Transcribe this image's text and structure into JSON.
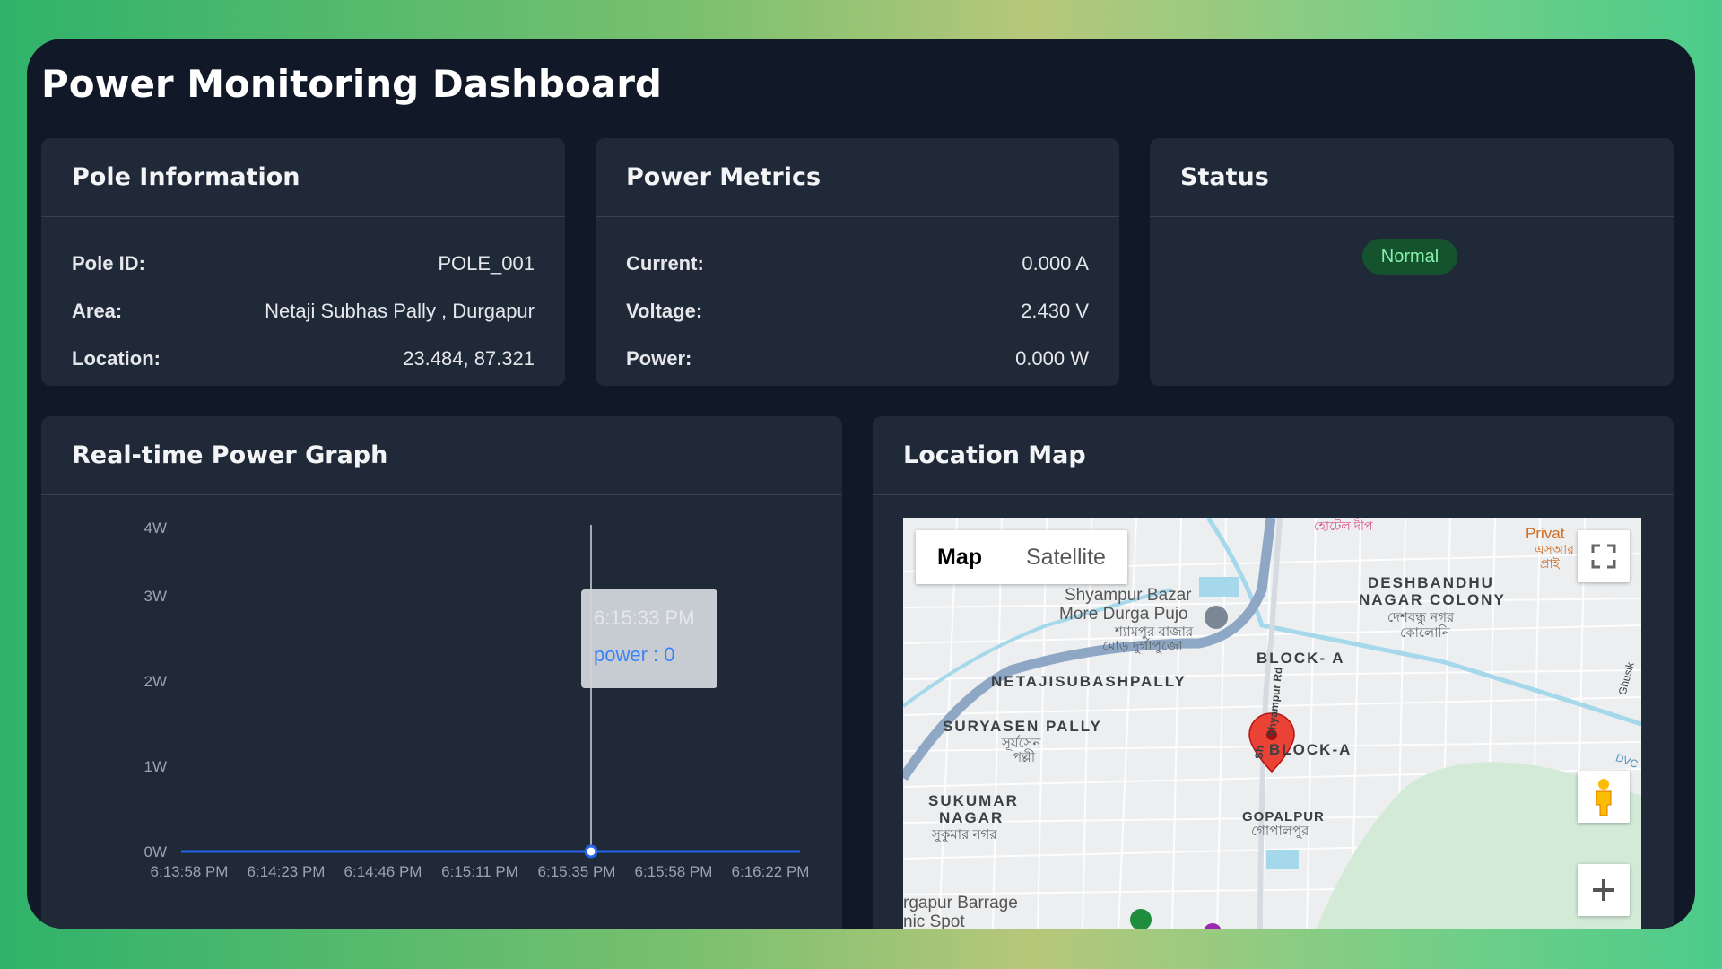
{
  "page": {
    "title": "Power Monitoring Dashboard"
  },
  "pole_info": {
    "header": "Pole Information",
    "rows": [
      {
        "label": "Pole ID:",
        "value": "POLE_001"
      },
      {
        "label": "Area:",
        "value": "Netaji Subhas Pally , Durgapur"
      },
      {
        "label": "Location:",
        "value": "23.484, 87.321"
      }
    ]
  },
  "power_metrics": {
    "header": "Power Metrics",
    "rows": [
      {
        "label": "Current:",
        "value": "0.000 A"
      },
      {
        "label": "Voltage:",
        "value": "2.430 V"
      },
      {
        "label": "Power:",
        "value": "0.000 W"
      }
    ]
  },
  "status": {
    "header": "Status",
    "badge": "Normal",
    "badge_color": "#14532d",
    "badge_text_color": "#86efac"
  },
  "graph": {
    "header": "Real-time Power Graph",
    "tooltip": {
      "time": "6:15:33 PM",
      "text": "power : 0"
    }
  },
  "chart_data": {
    "type": "line",
    "x": [
      "6:13:58 PM",
      "6:14:23 PM",
      "6:14:46 PM",
      "6:15:11 PM",
      "6:15:35 PM",
      "6:15:58 PM",
      "6:16:22 PM"
    ],
    "series": [
      {
        "name": "power",
        "values": [
          0,
          0,
          0,
          0,
          0,
          0,
          0
        ],
        "color": "#2563eb"
      }
    ],
    "y_ticks": [
      "0W",
      "1W",
      "2W",
      "3W",
      "4W"
    ],
    "ylim": [
      0,
      4
    ],
    "active_index": 4
  },
  "map": {
    "header": "Location Map",
    "type_buttons": [
      "Map",
      "Satellite"
    ],
    "labels": {
      "shyampur": "Shyampur Bazar",
      "durga": "More Durga Pujo",
      "shyampur_bn1": "শ্যামপুর বাজার",
      "shyampur_bn2": "মোড় দুর্গাপুজো",
      "deshbandhu1": "DESHBANDHU",
      "deshbandhu2": "NAGAR COLONY",
      "deshbandhu_bn1": "দেশবন্ধু নগর",
      "deshbandhu_bn2": "কোলোনি",
      "block_a1": "BLOCK- A",
      "netaji": "NETAJISUBASHPALLY",
      "suryasen": "SURYASEN PALLY",
      "suryasen_bn1": "সূর্যসেন",
      "suryasen_bn2": "পল্লী",
      "block_a2": "BLOCK-A",
      "sukumar1": "SUKUMAR",
      "sukumar2": "NAGAR",
      "sukumar_bn": "সুকুমার নগর",
      "gopalpur": "GOPALPUR",
      "gopalpur_bn": "গোপালপুর",
      "barrage1": "rgapur Barrage",
      "barrage2": "nic Spot",
      "hotel_bn": "হোটেল দীপ",
      "private1": "Privat",
      "private_bn1": "এসআর",
      "private_bn2": "প্রাই",
      "dvc": "DVC",
      "ghusik": "Ghusik",
      "road": "Shyampur Rd",
      "road_short": "Sh"
    }
  },
  "colors": {
    "background": "#111827",
    "card": "#1f2937",
    "accent": "#2563eb",
    "marker": "#ea4335"
  }
}
